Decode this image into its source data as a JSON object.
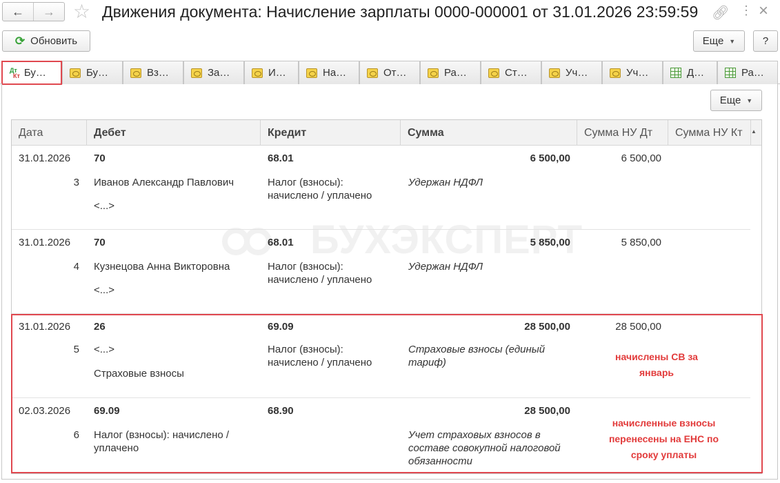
{
  "title": "Движения документа: Начисление зарплаты 0000-000001 от 31.01.2026 23:59:59",
  "toolbar": {
    "refresh": "Обновить",
    "more": "Еще",
    "help": "?"
  },
  "table_toolbar": {
    "more": "Еще"
  },
  "tabs": [
    {
      "label": "Бу…",
      "icon": "dt-kt-icon"
    },
    {
      "label": "Бу…",
      "icon": "register-icon"
    },
    {
      "label": "Вз…",
      "icon": "register-icon"
    },
    {
      "label": "За…",
      "icon": "register-icon"
    },
    {
      "label": "И…",
      "icon": "register-icon"
    },
    {
      "label": "На…",
      "icon": "register-icon"
    },
    {
      "label": "От…",
      "icon": "register-icon"
    },
    {
      "label": "Ра…",
      "icon": "register-icon"
    },
    {
      "label": "Ст…",
      "icon": "register-icon"
    },
    {
      "label": "Уч…",
      "icon": "register-icon"
    },
    {
      "label": "Уч…",
      "icon": "register-icon"
    },
    {
      "label": "Д…",
      "icon": "table-icon"
    },
    {
      "label": "Ра…",
      "icon": "table-icon"
    }
  ],
  "columns": {
    "date": "Дата",
    "debit": "Дебет",
    "credit": "Кредит",
    "sum": "Сумма",
    "sum_nu_dt": "Сумма НУ Дт",
    "sum_nu_kt": "Сумма НУ Кт"
  },
  "rows": [
    {
      "date": "31.01.2026",
      "num": "3",
      "debit": "70",
      "debit_sub1": "Иванов Александр Павлович",
      "debit_sub2": "<...>",
      "credit": "68.01",
      "credit_sub": "Налог (взносы): начислено / уплачено",
      "sum": "6 500,00",
      "content": "Удержан НДФЛ",
      "sum_nu_dt": "6 500,00"
    },
    {
      "date": "31.01.2026",
      "num": "4",
      "debit": "70",
      "debit_sub1": "Кузнецова Анна Викторовна",
      "debit_sub2": "<...>",
      "credit": "68.01",
      "credit_sub": "Налог (взносы): начислено / уплачено",
      "sum": "5 850,00",
      "content": "Удержан НДФЛ",
      "sum_nu_dt": "5 850,00"
    },
    {
      "date": "31.01.2026",
      "num": "5",
      "debit": "26",
      "debit_sub1": "<...>",
      "debit_sub2": "Страховые взносы",
      "credit": "69.09",
      "credit_sub": "Налог (взносы): начислено / уплачено",
      "sum": "28 500,00",
      "content": "Страховые взносы (единый тариф)",
      "sum_nu_dt": "28 500,00"
    },
    {
      "date": "02.03.2026",
      "num": "6",
      "debit": "69.09",
      "debit_sub1": "Налог (взносы): начислено / уплачено",
      "debit_sub2": "",
      "credit": "68.90",
      "credit_sub": "",
      "sum": "28 500,00",
      "content": "Учет страховых взносов в составе совокупной налоговой обязанности",
      "sum_nu_dt": ""
    }
  ],
  "annotations": {
    "note1": "начислены СВ за январь",
    "note2": "начисленные взносы перенесены на ЕНС по сроку уплаты"
  },
  "watermark": "БУХЭКСПЕРТ",
  "colors": {
    "highlight": "#e0484f",
    "note": "#e23b3b",
    "refresh_icon": "#3aa33a"
  }
}
